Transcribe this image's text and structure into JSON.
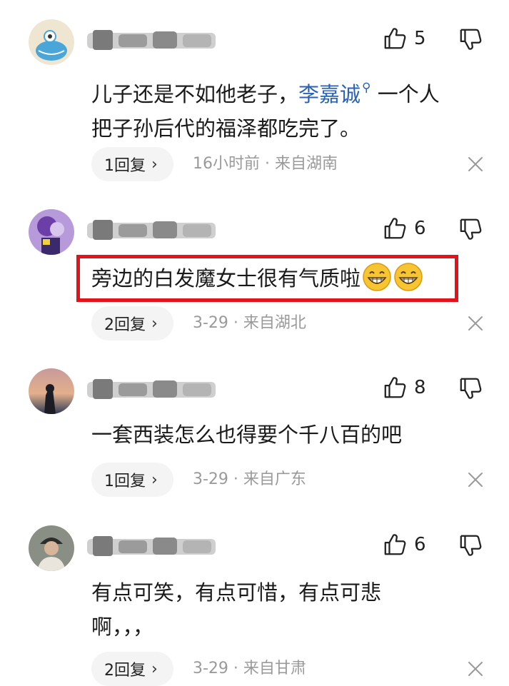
{
  "comments": [
    {
      "likes": "5",
      "content_before": "儿子还是不如他老子，",
      "link_text": "李嘉诚",
      "link_icon": "search-icon",
      "content_after_line1": "一个人",
      "content_line2": "把子孙后代的福泽都吃完了。",
      "reply_label": "1回复",
      "meta": "16小时前 · 来自湖南"
    },
    {
      "likes": "6",
      "content": "旁边的白发魔女士很有气质啦",
      "emojis": [
        "grin-emoji",
        "grin-emoji"
      ],
      "reply_label": "2回复",
      "meta": "3-29 · 来自湖北",
      "highlighted": true
    },
    {
      "likes": "8",
      "content": "一套西装怎么也得要个千八百的吧",
      "reply_label": "1回复",
      "meta": "3-29 · 来自广东"
    },
    {
      "likes": "6",
      "content_line1": "有点可笑，有点可惜，有点可悲",
      "content_line2": "啊，，，",
      "reply_label": "2回复",
      "meta": "3-29 · 来自甘肃"
    }
  ],
  "icons": {
    "like": "thumbs-up-icon",
    "dislike": "thumbs-down-icon",
    "close": "close-icon",
    "chevron": "chevron-right-icon"
  },
  "colors": {
    "link": "#2a62b8",
    "meta": "#9a9a9a",
    "reply_bg": "#f4f4f4",
    "highlight": "#e1141c"
  }
}
